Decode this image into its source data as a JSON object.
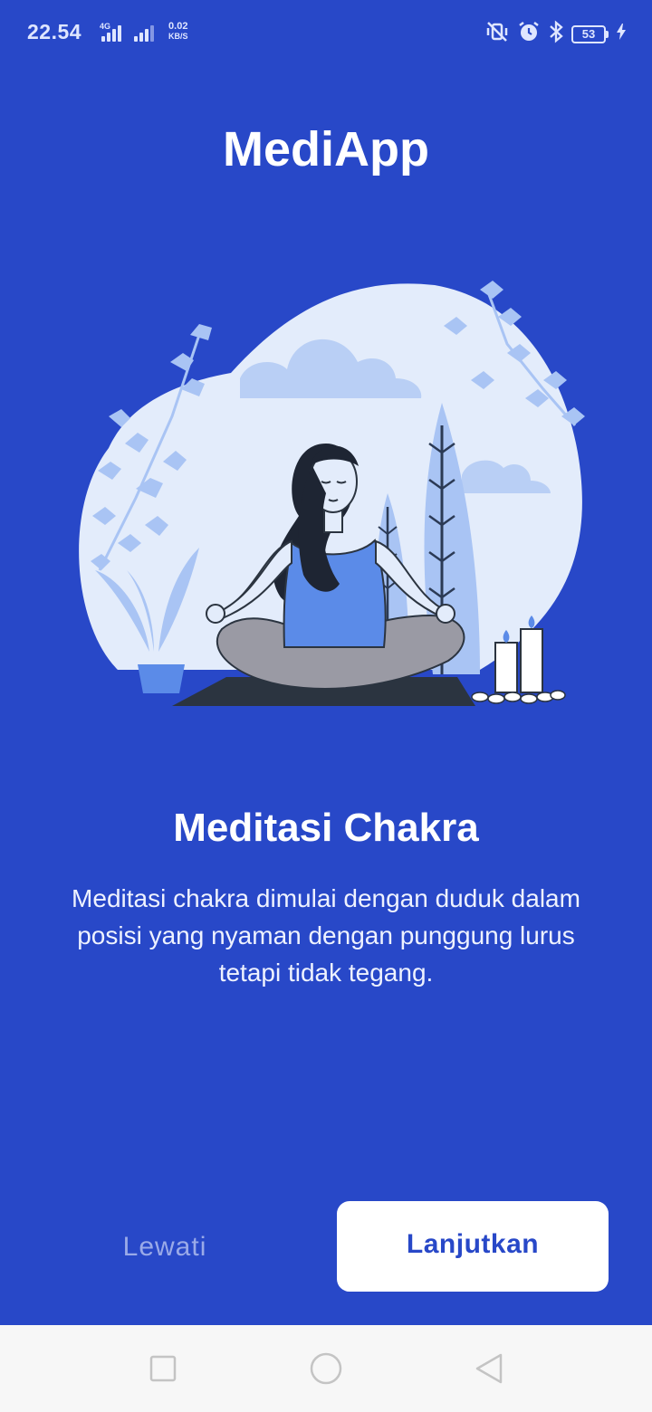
{
  "status_bar": {
    "time": "22.54",
    "network_label": "4G",
    "speed_value": "0.02",
    "speed_unit": "KB/S",
    "battery_level": "53",
    "icons": [
      "signal-icon",
      "signal-icon",
      "mute-vibrate-icon",
      "alarm-icon",
      "bluetooth-icon",
      "battery-icon",
      "charging-icon"
    ]
  },
  "app": {
    "title": "MediApp"
  },
  "onboarding": {
    "illustration": "meditating-woman-illustration",
    "headline": "Meditasi Chakra",
    "description": "Meditasi chakra dimulai dengan duduk dalam posisi yang nyaman dengan punggung lurus tetapi tidak tegang."
  },
  "actions": {
    "skip_label": "Lewati",
    "next_label": "Lanjutkan"
  },
  "nav_bar": {
    "icons": [
      "recents-icon",
      "home-icon",
      "back-icon"
    ]
  },
  "colors": {
    "background": "#2848c8",
    "button_bg": "#ffffff",
    "button_text": "#2848c8",
    "skip_text": "#9aaae8",
    "illustration_blob": "#e3ecfb",
    "illustration_accent": "#a9c4f4"
  }
}
